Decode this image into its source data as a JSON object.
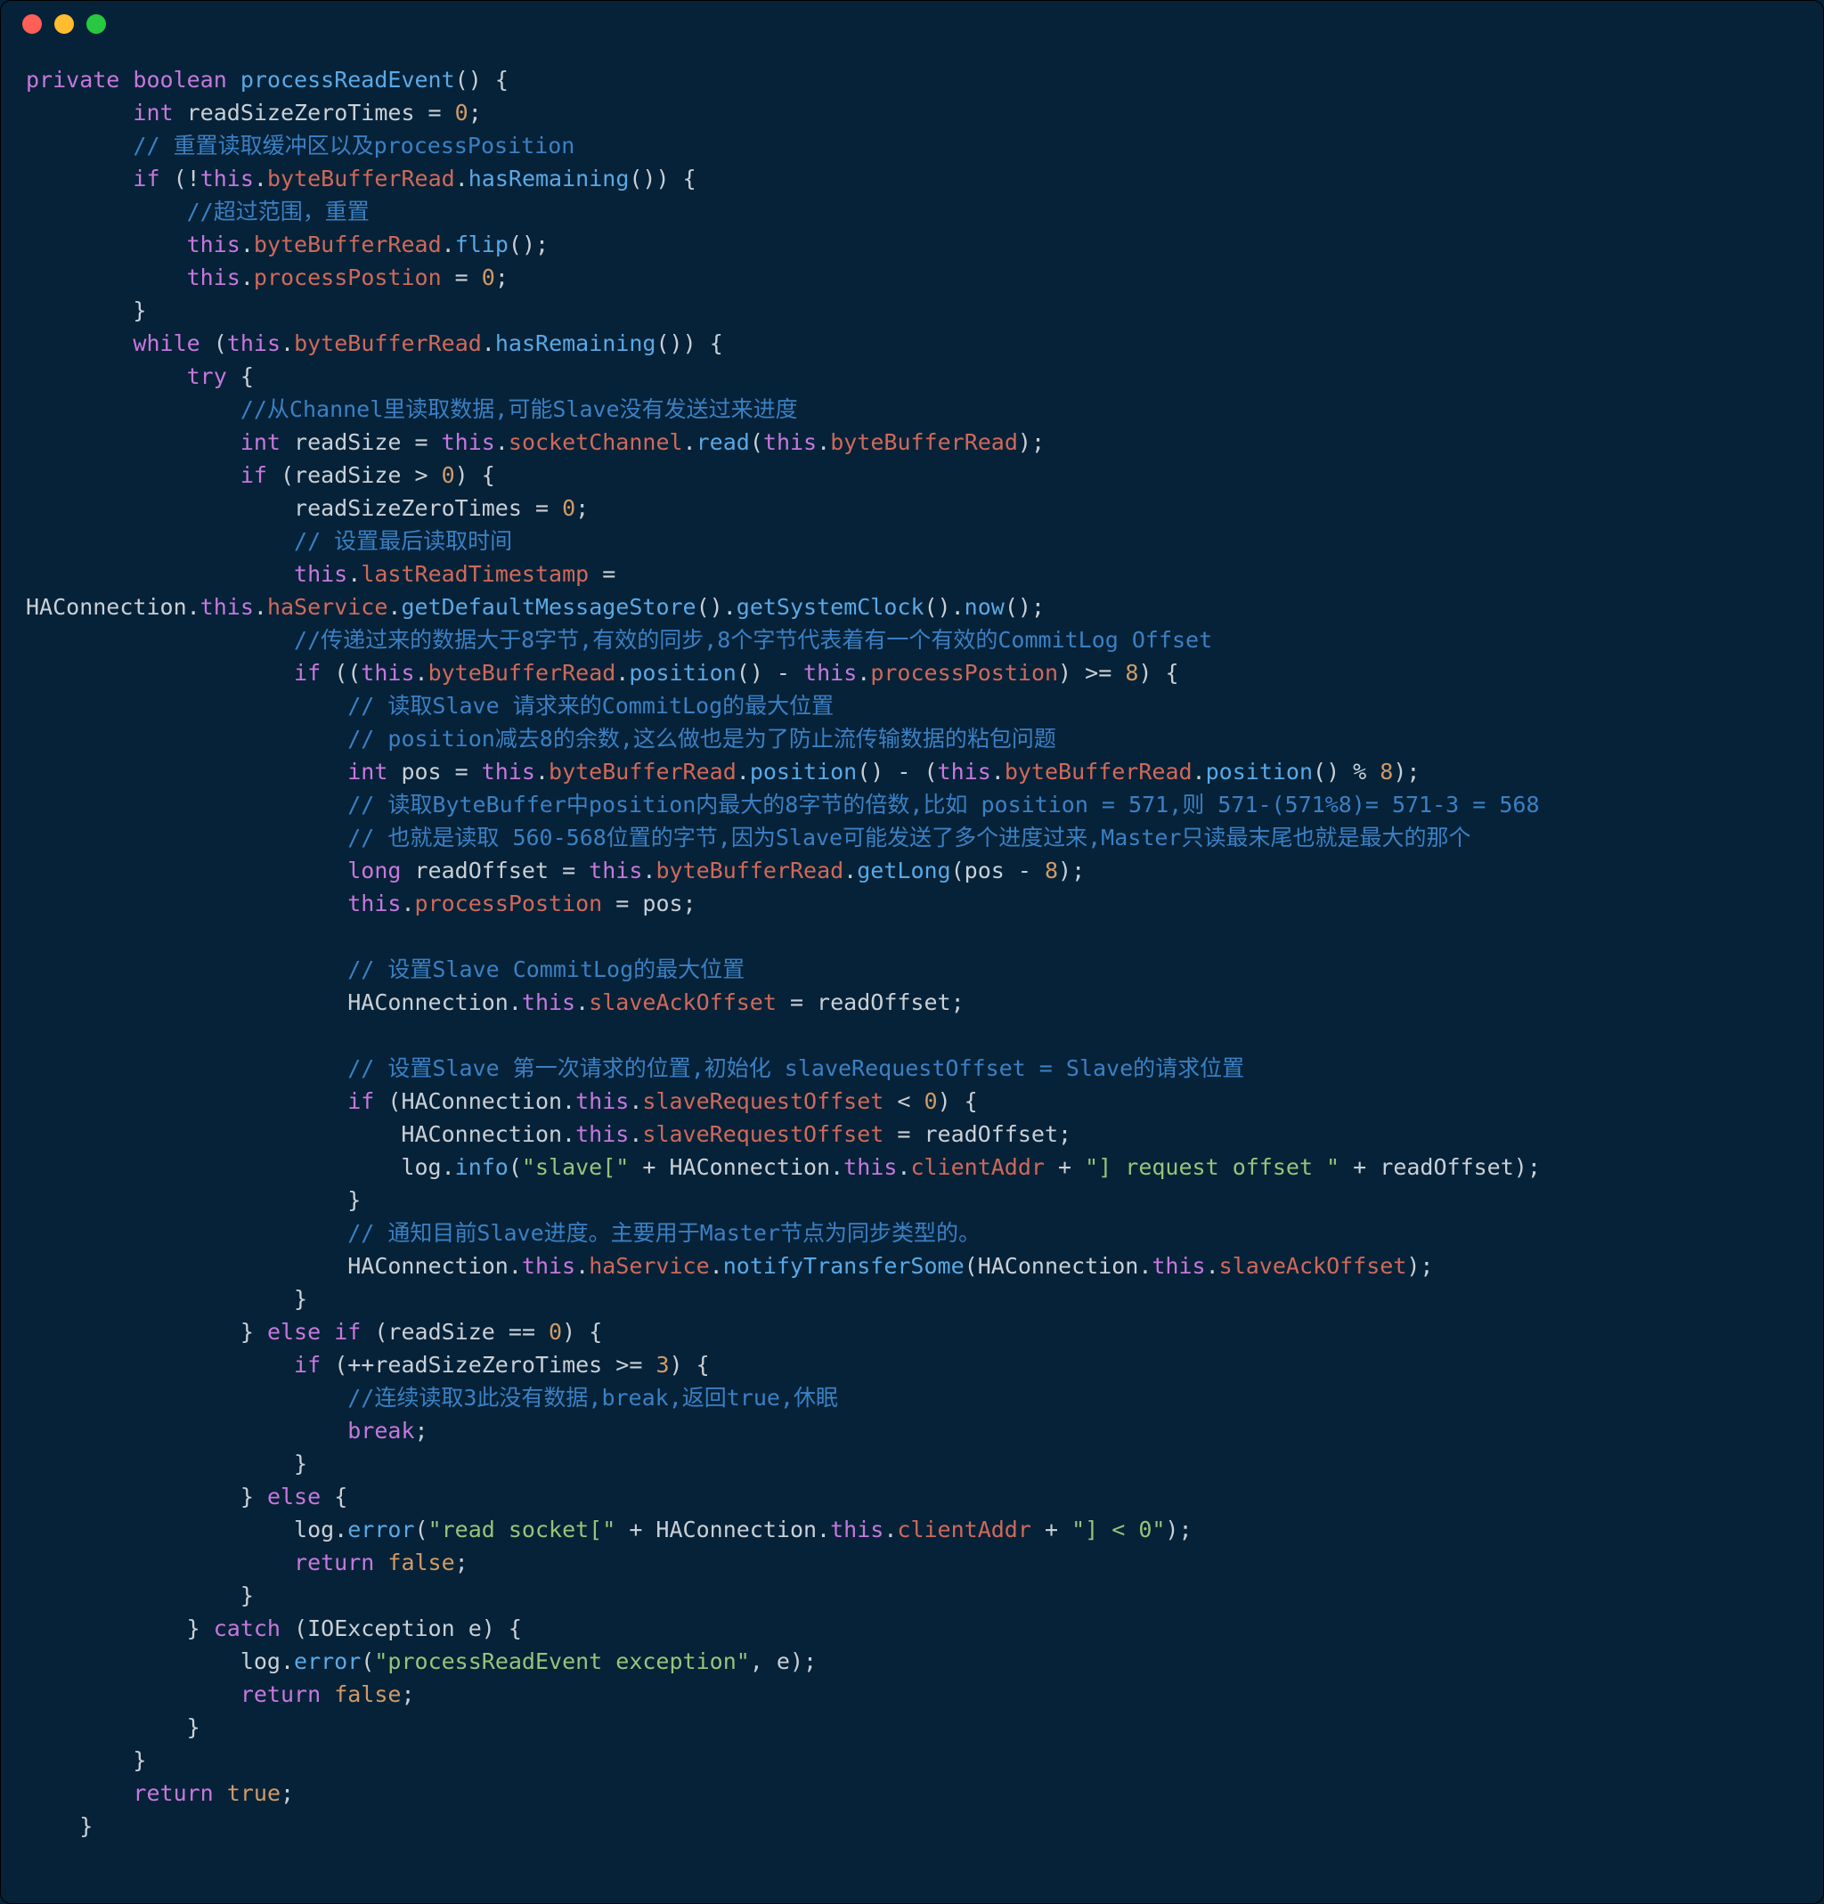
{
  "window": {
    "kind": "mac-terminal-code"
  },
  "code": {
    "lines": [
      [
        [
          "kw",
          "private"
        ],
        [
          "pun",
          " "
        ],
        [
          "type",
          "boolean"
        ],
        [
          "pun",
          " "
        ],
        [
          "fn",
          "processReadEvent"
        ],
        [
          "pun",
          "() {"
        ]
      ],
      [
        [
          "pun",
          "        "
        ],
        [
          "type",
          "int"
        ],
        [
          "pun",
          " readSizeZeroTimes = "
        ],
        [
          "num",
          "0"
        ],
        [
          "pun",
          ";"
        ]
      ],
      [
        [
          "pun",
          "        "
        ],
        [
          "cmt",
          "// 重置读取缓冲区以及processPosition"
        ]
      ],
      [
        [
          "pun",
          "        "
        ],
        [
          "kw",
          "if"
        ],
        [
          "pun",
          " (!"
        ],
        [
          "kw",
          "this"
        ],
        [
          "pun",
          "."
        ],
        [
          "prop",
          "byteBufferRead"
        ],
        [
          "pun",
          "."
        ],
        [
          "fn",
          "hasRemaining"
        ],
        [
          "pun",
          "()) {"
        ]
      ],
      [
        [
          "pun",
          "            "
        ],
        [
          "cmt",
          "//超过范围，重置"
        ]
      ],
      [
        [
          "pun",
          "            "
        ],
        [
          "kw",
          "this"
        ],
        [
          "pun",
          "."
        ],
        [
          "prop",
          "byteBufferRead"
        ],
        [
          "pun",
          "."
        ],
        [
          "fn",
          "flip"
        ],
        [
          "pun",
          "();"
        ]
      ],
      [
        [
          "pun",
          "            "
        ],
        [
          "kw",
          "this"
        ],
        [
          "pun",
          "."
        ],
        [
          "prop",
          "processPostion"
        ],
        [
          "pun",
          " = "
        ],
        [
          "num",
          "0"
        ],
        [
          "pun",
          ";"
        ]
      ],
      [
        [
          "pun",
          "        }"
        ]
      ],
      [
        [
          "pun",
          "        "
        ],
        [
          "kw",
          "while"
        ],
        [
          "pun",
          " ("
        ],
        [
          "kw",
          "this"
        ],
        [
          "pun",
          "."
        ],
        [
          "prop",
          "byteBufferRead"
        ],
        [
          "pun",
          "."
        ],
        [
          "fn",
          "hasRemaining"
        ],
        [
          "pun",
          "()) {"
        ]
      ],
      [
        [
          "pun",
          "            "
        ],
        [
          "kw",
          "try"
        ],
        [
          "pun",
          " {"
        ]
      ],
      [
        [
          "pun",
          "                "
        ],
        [
          "cmt",
          "//从Channel里读取数据,可能Slave没有发送过来进度"
        ]
      ],
      [
        [
          "pun",
          "                "
        ],
        [
          "type",
          "int"
        ],
        [
          "pun",
          " readSize = "
        ],
        [
          "kw",
          "this"
        ],
        [
          "pun",
          "."
        ],
        [
          "prop",
          "socketChannel"
        ],
        [
          "pun",
          "."
        ],
        [
          "fn",
          "read"
        ],
        [
          "pun",
          "("
        ],
        [
          "kw",
          "this"
        ],
        [
          "pun",
          "."
        ],
        [
          "prop",
          "byteBufferRead"
        ],
        [
          "pun",
          ");"
        ]
      ],
      [
        [
          "pun",
          "                "
        ],
        [
          "kw",
          "if"
        ],
        [
          "pun",
          " (readSize > "
        ],
        [
          "num",
          "0"
        ],
        [
          "pun",
          ") {"
        ]
      ],
      [
        [
          "pun",
          "                    readSizeZeroTimes = "
        ],
        [
          "num",
          "0"
        ],
        [
          "pun",
          ";"
        ]
      ],
      [
        [
          "pun",
          "                    "
        ],
        [
          "cmt",
          "// 设置最后读取时间"
        ]
      ],
      [
        [
          "pun",
          "                    "
        ],
        [
          "kw",
          "this"
        ],
        [
          "pun",
          "."
        ],
        [
          "prop",
          "lastReadTimestamp"
        ],
        [
          "pun",
          " ="
        ]
      ],
      [
        [
          "pun",
          "HAConnection."
        ],
        [
          "kw",
          "this"
        ],
        [
          "pun",
          "."
        ],
        [
          "prop",
          "haService"
        ],
        [
          "pun",
          "."
        ],
        [
          "fn",
          "getDefaultMessageStore"
        ],
        [
          "pun",
          "()."
        ],
        [
          "fn",
          "getSystemClock"
        ],
        [
          "pun",
          "()."
        ],
        [
          "fn",
          "now"
        ],
        [
          "pun",
          "();"
        ]
      ],
      [
        [
          "pun",
          "                    "
        ],
        [
          "cmt",
          "//传递过来的数据大于8字节,有效的同步,8个字节代表着有一个有效的CommitLog Offset"
        ]
      ],
      [
        [
          "pun",
          "                    "
        ],
        [
          "kw",
          "if"
        ],
        [
          "pun",
          " (("
        ],
        [
          "kw",
          "this"
        ],
        [
          "pun",
          "."
        ],
        [
          "prop",
          "byteBufferRead"
        ],
        [
          "pun",
          "."
        ],
        [
          "fn",
          "position"
        ],
        [
          "pun",
          "() - "
        ],
        [
          "kw",
          "this"
        ],
        [
          "pun",
          "."
        ],
        [
          "prop",
          "processPostion"
        ],
        [
          "pun",
          ") >= "
        ],
        [
          "num",
          "8"
        ],
        [
          "pun",
          ") {"
        ]
      ],
      [
        [
          "pun",
          "                        "
        ],
        [
          "cmt",
          "// 读取Slave 请求来的CommitLog的最大位置"
        ]
      ],
      [
        [
          "pun",
          "                        "
        ],
        [
          "cmt",
          "// position减去8的余数,这么做也是为了防止流传输数据的粘包问题"
        ]
      ],
      [
        [
          "pun",
          "                        "
        ],
        [
          "type",
          "int"
        ],
        [
          "pun",
          " pos = "
        ],
        [
          "kw",
          "this"
        ],
        [
          "pun",
          "."
        ],
        [
          "prop",
          "byteBufferRead"
        ],
        [
          "pun",
          "."
        ],
        [
          "fn",
          "position"
        ],
        [
          "pun",
          "() - ("
        ],
        [
          "kw",
          "this"
        ],
        [
          "pun",
          "."
        ],
        [
          "prop",
          "byteBufferRead"
        ],
        [
          "pun",
          "."
        ],
        [
          "fn",
          "position"
        ],
        [
          "pun",
          "() % "
        ],
        [
          "num",
          "8"
        ],
        [
          "pun",
          ");"
        ]
      ],
      [
        [
          "pun",
          "                        "
        ],
        [
          "cmt",
          "// 读取ByteBuffer中position内最大的8字节的倍数,比如 position = 571,则 571-(571%8)= 571-3 = 568"
        ]
      ],
      [
        [
          "pun",
          "                        "
        ],
        [
          "cmt",
          "// 也就是读取 560-568位置的字节,因为Slave可能发送了多个进度过来,Master只读最末尾也就是最大的那个"
        ]
      ],
      [
        [
          "pun",
          "                        "
        ],
        [
          "type",
          "long"
        ],
        [
          "pun",
          " readOffset = "
        ],
        [
          "kw",
          "this"
        ],
        [
          "pun",
          "."
        ],
        [
          "prop",
          "byteBufferRead"
        ],
        [
          "pun",
          "."
        ],
        [
          "fn",
          "getLong"
        ],
        [
          "pun",
          "(pos - "
        ],
        [
          "num",
          "8"
        ],
        [
          "pun",
          ");"
        ]
      ],
      [
        [
          "pun",
          "                        "
        ],
        [
          "kw",
          "this"
        ],
        [
          "pun",
          "."
        ],
        [
          "prop",
          "processPostion"
        ],
        [
          "pun",
          " = pos;"
        ]
      ],
      [
        [
          "pun",
          ""
        ]
      ],
      [
        [
          "pun",
          "                        "
        ],
        [
          "cmt",
          "// 设置Slave CommitLog的最大位置"
        ]
      ],
      [
        [
          "pun",
          "                        HAConnection."
        ],
        [
          "kw",
          "this"
        ],
        [
          "pun",
          "."
        ],
        [
          "prop",
          "slaveAckOffset"
        ],
        [
          "pun",
          " = readOffset;"
        ]
      ],
      [
        [
          "pun",
          ""
        ]
      ],
      [
        [
          "pun",
          "                        "
        ],
        [
          "cmt",
          "// 设置Slave 第一次请求的位置,初始化 slaveRequestOffset = Slave的请求位置"
        ]
      ],
      [
        [
          "pun",
          "                        "
        ],
        [
          "kw",
          "if"
        ],
        [
          "pun",
          " (HAConnection."
        ],
        [
          "kw",
          "this"
        ],
        [
          "pun",
          "."
        ],
        [
          "prop",
          "slaveRequestOffset"
        ],
        [
          "pun",
          " < "
        ],
        [
          "num",
          "0"
        ],
        [
          "pun",
          ") {"
        ]
      ],
      [
        [
          "pun",
          "                            HAConnection."
        ],
        [
          "kw",
          "this"
        ],
        [
          "pun",
          "."
        ],
        [
          "prop",
          "slaveRequestOffset"
        ],
        [
          "pun",
          " = readOffset;"
        ]
      ],
      [
        [
          "pun",
          "                            log."
        ],
        [
          "fn",
          "info"
        ],
        [
          "pun",
          "("
        ],
        [
          "str",
          "\"slave[\""
        ],
        [
          "pun",
          " + HAConnection."
        ],
        [
          "kw",
          "this"
        ],
        [
          "pun",
          "."
        ],
        [
          "prop",
          "clientAddr"
        ],
        [
          "pun",
          " + "
        ],
        [
          "str",
          "\"] request offset \""
        ],
        [
          "pun",
          " + readOffset);"
        ]
      ],
      [
        [
          "pun",
          "                        }"
        ]
      ],
      [
        [
          "pun",
          "                        "
        ],
        [
          "cmt",
          "// 通知目前Slave进度。主要用于Master节点为同步类型的。"
        ]
      ],
      [
        [
          "pun",
          "                        HAConnection."
        ],
        [
          "kw",
          "this"
        ],
        [
          "pun",
          "."
        ],
        [
          "prop",
          "haService"
        ],
        [
          "pun",
          "."
        ],
        [
          "fn",
          "notifyTransferSome"
        ],
        [
          "pun",
          "(HAConnection."
        ],
        [
          "kw",
          "this"
        ],
        [
          "pun",
          "."
        ],
        [
          "prop",
          "slaveAckOffset"
        ],
        [
          "pun",
          ");"
        ]
      ],
      [
        [
          "pun",
          "                    }"
        ]
      ],
      [
        [
          "pun",
          "                } "
        ],
        [
          "kw",
          "else"
        ],
        [
          "pun",
          " "
        ],
        [
          "kw",
          "if"
        ],
        [
          "pun",
          " (readSize == "
        ],
        [
          "num",
          "0"
        ],
        [
          "pun",
          ") {"
        ]
      ],
      [
        [
          "pun",
          "                    "
        ],
        [
          "kw",
          "if"
        ],
        [
          "pun",
          " (++readSizeZeroTimes >= "
        ],
        [
          "num",
          "3"
        ],
        [
          "pun",
          ") {"
        ]
      ],
      [
        [
          "pun",
          "                        "
        ],
        [
          "cmt",
          "//连续读取3此没有数据,break,返回true,休眠"
        ]
      ],
      [
        [
          "pun",
          "                        "
        ],
        [
          "kw",
          "break"
        ],
        [
          "pun",
          ";"
        ]
      ],
      [
        [
          "pun",
          "                    }"
        ]
      ],
      [
        [
          "pun",
          "                } "
        ],
        [
          "kw",
          "else"
        ],
        [
          "pun",
          " {"
        ]
      ],
      [
        [
          "pun",
          "                    log."
        ],
        [
          "fn",
          "error"
        ],
        [
          "pun",
          "("
        ],
        [
          "str",
          "\"read socket[\""
        ],
        [
          "pun",
          " + HAConnection."
        ],
        [
          "kw",
          "this"
        ],
        [
          "pun",
          "."
        ],
        [
          "prop",
          "clientAddr"
        ],
        [
          "pun",
          " + "
        ],
        [
          "str",
          "\"] < 0\""
        ],
        [
          "pun",
          ");"
        ]
      ],
      [
        [
          "pun",
          "                    "
        ],
        [
          "kw",
          "return"
        ],
        [
          "pun",
          " "
        ],
        [
          "bool",
          "false"
        ],
        [
          "pun",
          ";"
        ]
      ],
      [
        [
          "pun",
          "                }"
        ]
      ],
      [
        [
          "pun",
          "            } "
        ],
        [
          "kw",
          "catch"
        ],
        [
          "pun",
          " (IOException e) {"
        ]
      ],
      [
        [
          "pun",
          "                log."
        ],
        [
          "fn",
          "error"
        ],
        [
          "pun",
          "("
        ],
        [
          "str",
          "\"processReadEvent exception\""
        ],
        [
          "pun",
          ", e);"
        ]
      ],
      [
        [
          "pun",
          "                "
        ],
        [
          "kw",
          "return"
        ],
        [
          "pun",
          " "
        ],
        [
          "bool",
          "false"
        ],
        [
          "pun",
          ";"
        ]
      ],
      [
        [
          "pun",
          "            }"
        ]
      ],
      [
        [
          "pun",
          "        }"
        ]
      ],
      [
        [
          "pun",
          "        "
        ],
        [
          "kw",
          "return"
        ],
        [
          "pun",
          " "
        ],
        [
          "bool",
          "true"
        ],
        [
          "pun",
          ";"
        ]
      ],
      [
        [
          "pun",
          "    }"
        ]
      ]
    ]
  }
}
